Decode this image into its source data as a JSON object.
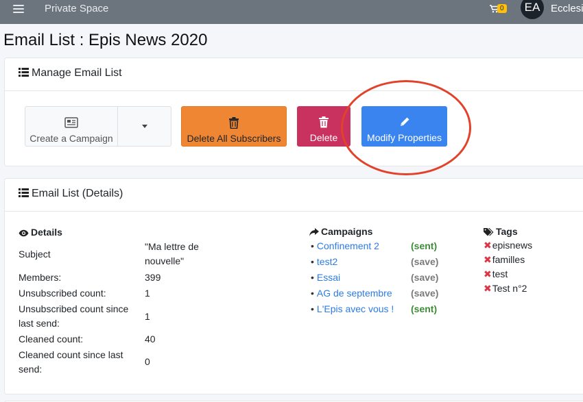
{
  "topbar": {
    "brand": "Private Space",
    "cart_count": "0",
    "avatar_initials": "EA",
    "user_name": "Ecclesia"
  },
  "page": {
    "title": "Email List : Epis News 2020"
  },
  "manage_card": {
    "title": "Manage Email List",
    "buttons": {
      "create_campaign": "Create a Campaign",
      "delete_all": "Delete All Subscribers",
      "delete": "Delete",
      "modify": "Modify Properties"
    }
  },
  "details_card": {
    "title": "Email List (Details)",
    "details_heading": "Details",
    "subject_label": "Subject",
    "subject_value_line1": "\"Ma lettre de",
    "subject_value_line2": "nouvelle\"",
    "members_label": "Members:",
    "members_value": "399",
    "unsub_label": "Unsubscribed count:",
    "unsub_value": "1",
    "unsub_since_label_line1": "Unsubscribed count since",
    "unsub_since_label_line2": "last send:",
    "unsub_since_value": "1",
    "cleaned_label": "Cleaned count:",
    "cleaned_value": "40",
    "cleaned_since_label_line1": "Cleaned count since last",
    "cleaned_since_label_line2": "send:",
    "cleaned_since_value": "0",
    "campaigns_heading": "Campaigns",
    "campaigns": [
      {
        "name": "Confinement 2",
        "status": "(sent)"
      },
      {
        "name": "test2",
        "status": "(save)"
      },
      {
        "name": "Essai",
        "status": "(save)"
      },
      {
        "name": "AG de septembre",
        "status": "(save)"
      },
      {
        "name": "L'Epis avec vous !",
        "status": "(sent)"
      }
    ],
    "tags_heading": "Tags",
    "tags": [
      "episnews",
      "familles",
      "test",
      "Test n°2"
    ]
  },
  "colors": {
    "topbar": "#6c757d",
    "orange": "#ee8634",
    "red": "#c9325f",
    "blue": "#3a84f0",
    "sent": "#3d8b37",
    "save": "#7a7a7a",
    "link": "#2c7be5",
    "annotation": "#e2422a"
  }
}
